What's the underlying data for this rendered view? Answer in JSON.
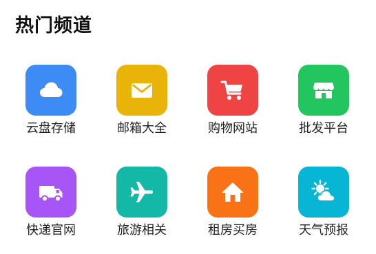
{
  "section": {
    "title": "热门频道"
  },
  "channels": [
    {
      "label": "云盘存储",
      "icon": "cloud-icon",
      "color": "#3d8bf5"
    },
    {
      "label": "邮箱大全",
      "icon": "mail-icon",
      "color": "#eab308"
    },
    {
      "label": "购物网站",
      "icon": "shopping-cart-icon",
      "color": "#ef4444"
    },
    {
      "label": "批发平台",
      "icon": "storefront-icon",
      "color": "#22c55e"
    },
    {
      "label": "快递官网",
      "icon": "delivery-truck-icon",
      "color": "#a855f7"
    },
    {
      "label": "旅游相关",
      "icon": "airplane-icon",
      "color": "#14b8a6"
    },
    {
      "label": "租房买房",
      "icon": "house-icon",
      "color": "#f97316"
    },
    {
      "label": "天气预报",
      "icon": "weather-sun-cloud-icon",
      "color": "#06b6d4"
    }
  ]
}
